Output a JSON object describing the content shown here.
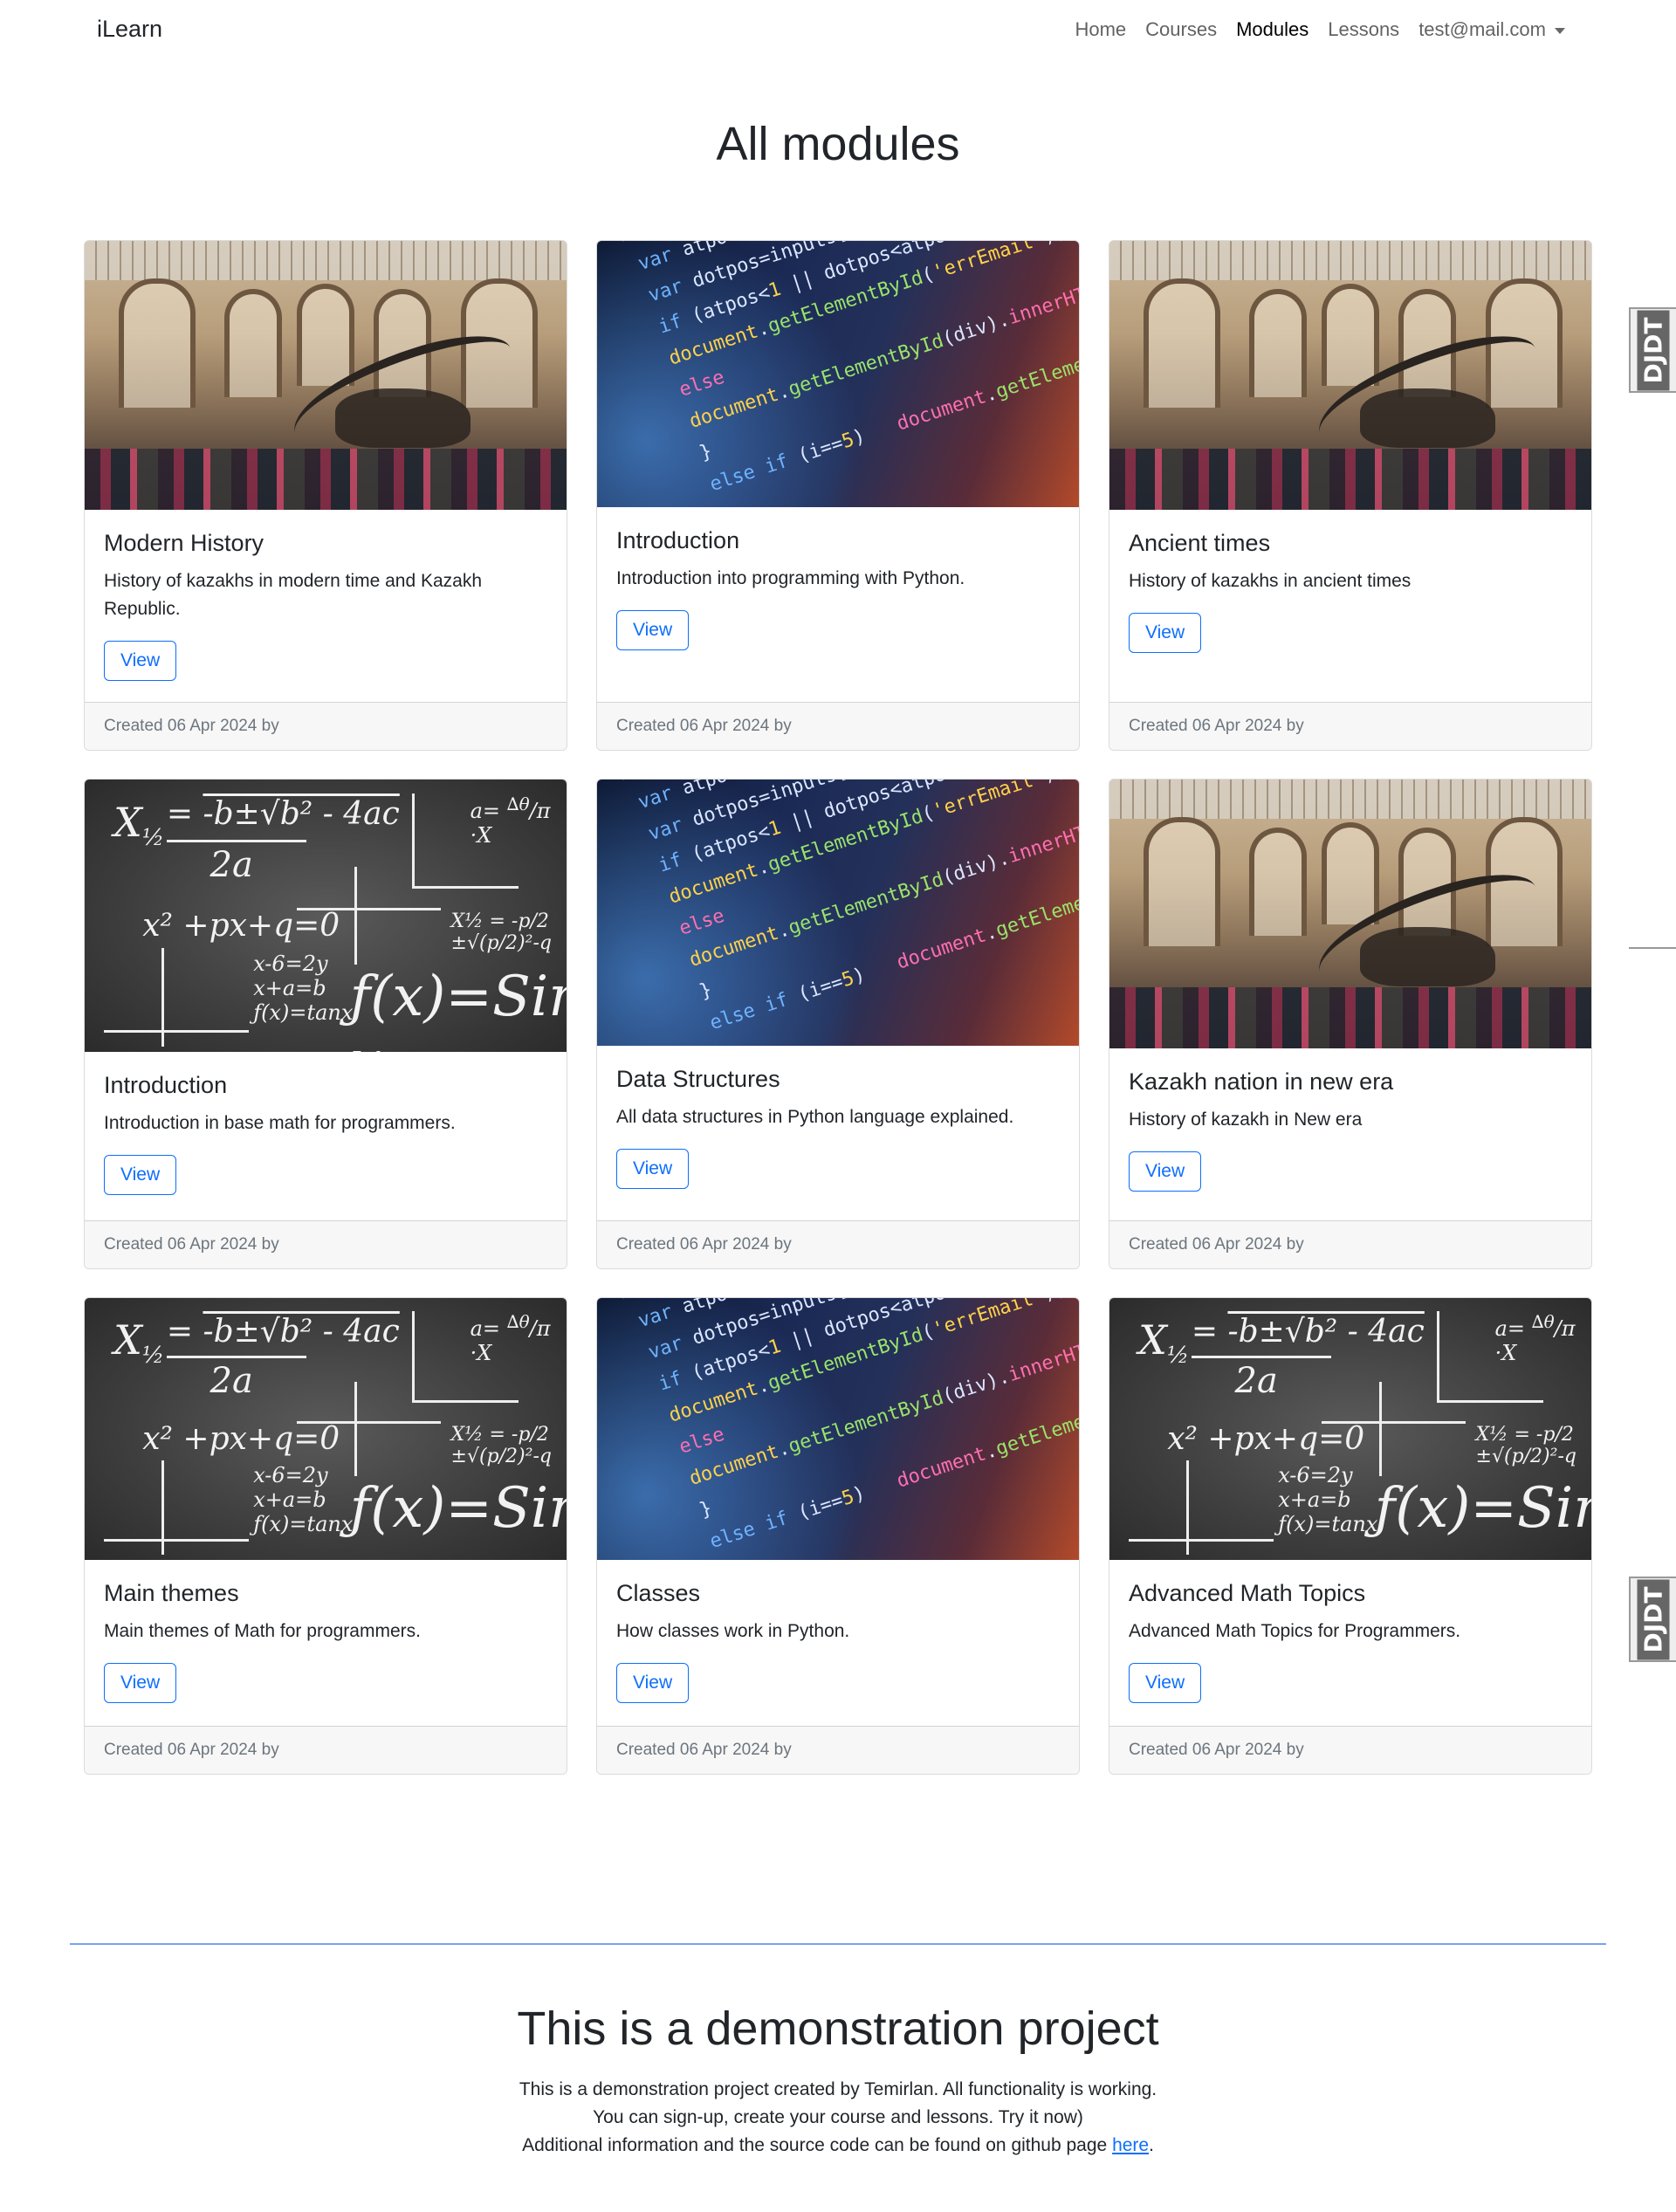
{
  "navbar": {
    "brand": "iLearn",
    "links": [
      "Home",
      "Courses",
      "Modules",
      "Lessons"
    ],
    "active": "Modules",
    "user": "test@mail.com"
  },
  "page": {
    "title": "All modules"
  },
  "cards": [
    {
      "title": "Modern History",
      "text": "History of kazakhs in modern time and Kazakh Republic.",
      "button": "View",
      "footer": "Created 06 Apr 2024 by",
      "image": "museum"
    },
    {
      "title": "Introduction",
      "text": "Introduction into programming with Python.",
      "button": "View",
      "footer": "Created 06 Apr 2024 by",
      "image": "code"
    },
    {
      "title": "Ancient times",
      "text": "History of kazakhs in ancient times",
      "button": "View",
      "footer": "Created 06 Apr 2024 by",
      "image": "museum"
    },
    {
      "title": "Introduction",
      "text": "Introduction in base math for programmers.",
      "button": "View",
      "footer": "Created 06 Apr 2024 by",
      "image": "chalkboard"
    },
    {
      "title": "Data Structures",
      "text": "All data structures in Python language explained.",
      "button": "View",
      "footer": "Created 06 Apr 2024 by",
      "image": "code"
    },
    {
      "title": "Kazakh nation in new era",
      "text": "History of kazakh in New era",
      "button": "View",
      "footer": "Created 06 Apr 2024 by",
      "image": "museum"
    },
    {
      "title": "Main themes",
      "text": "Main themes of Math for programmers.",
      "button": "View",
      "footer": "Created 06 Apr 2024 by",
      "image": "chalkboard"
    },
    {
      "title": "Classes",
      "text": "How classes work in Python.",
      "button": "View",
      "footer": "Created 06 Apr 2024 by",
      "image": "code"
    },
    {
      "title": "Advanced Math Topics",
      "text": "Advanced Math Topics for Programmers.",
      "button": "View",
      "footer": "Created 06 Apr 2024 by",
      "image": "chalkboard"
    }
  ],
  "djdt": {
    "label": "DJDT"
  },
  "footer": {
    "title": "This is a demonstration project",
    "line1": "This is a demonstration project created by Temirlan. All functionality is working.",
    "line2": "You can sign-up, create your course and lessons. Try it now)",
    "line3_prefix": "Additional information and the source code can be found on github page ",
    "link": "here",
    "line3_suffix": "."
  },
  "colors": {
    "primary": "#0d6efd",
    "divider": "#7aa2f0",
    "footer_bg": "#f7f7f7"
  }
}
